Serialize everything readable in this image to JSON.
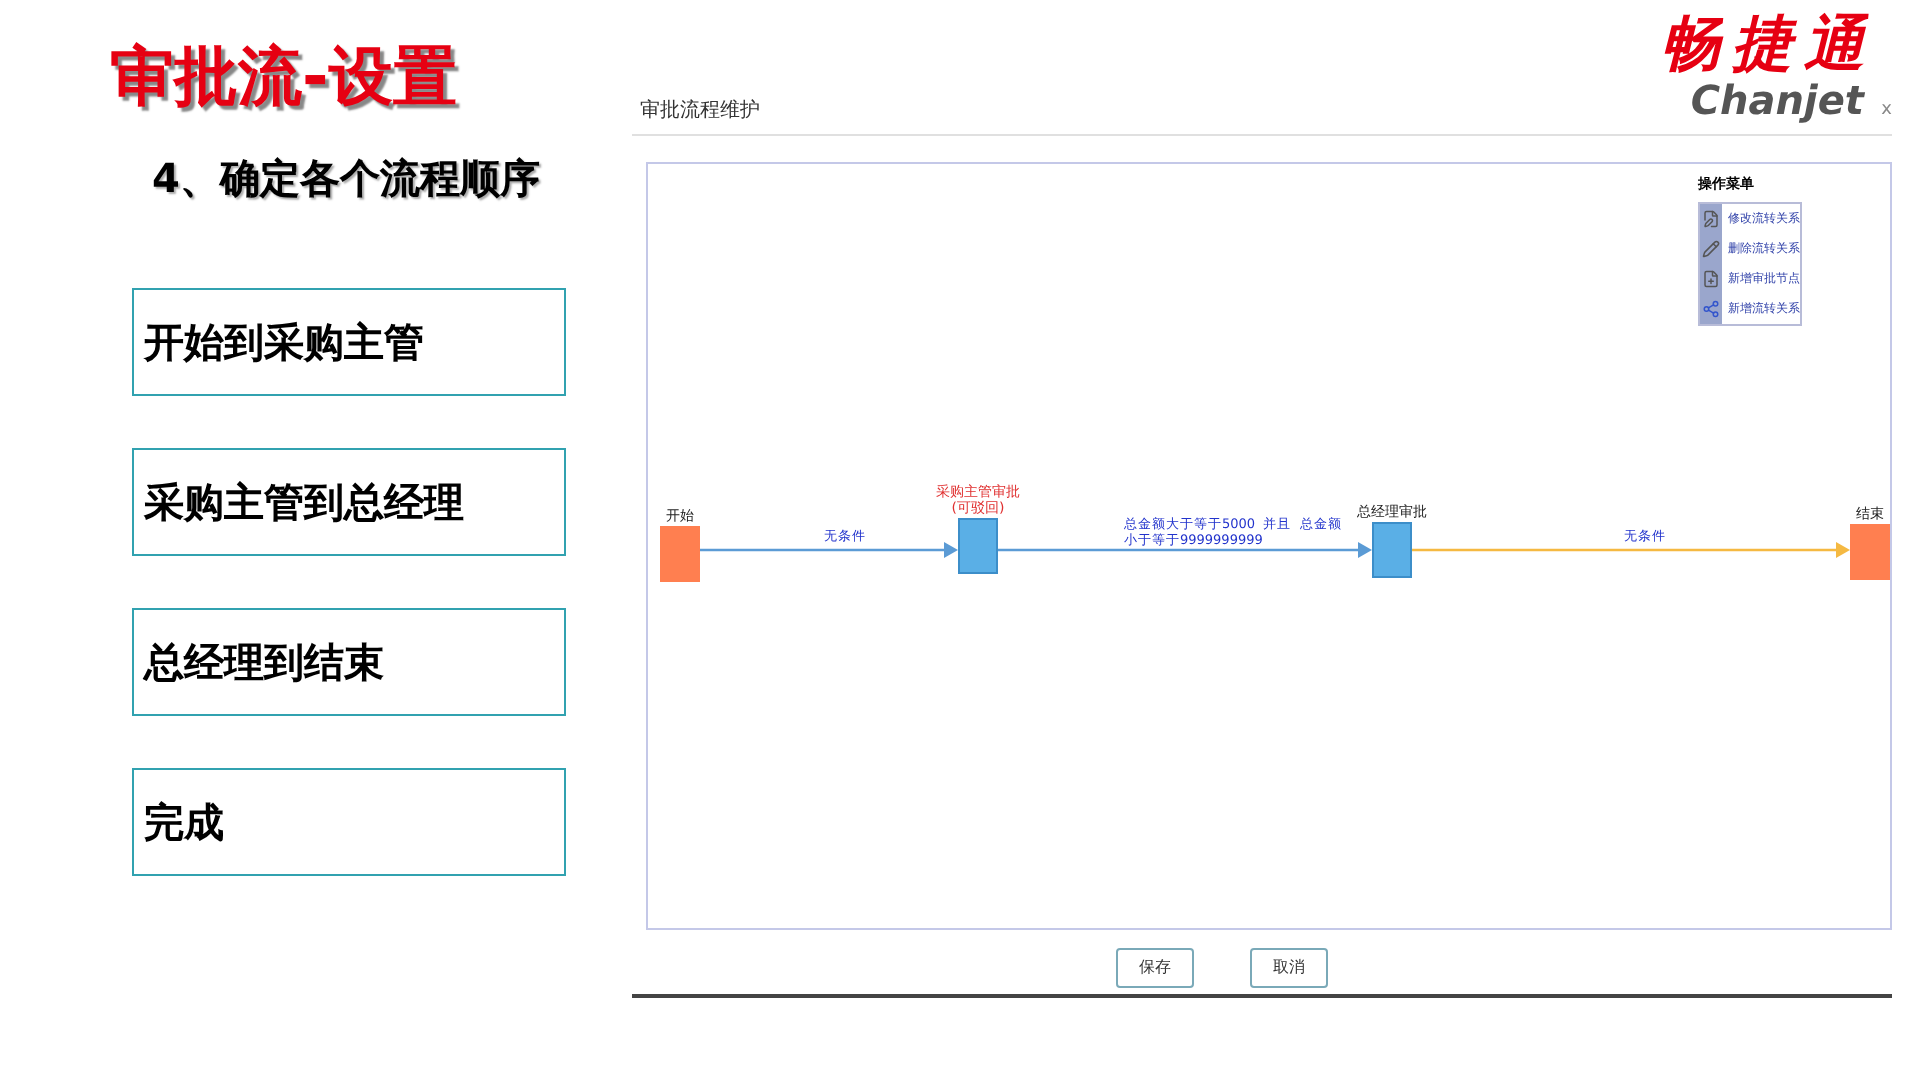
{
  "title": "审批流-设置",
  "logo": {
    "name": "畅捷通",
    "latin": "Chanjet"
  },
  "subtitle": "4、确定各个流程顺序",
  "steps": [
    "开始到采购主管",
    "采购主管到总经理",
    "总经理到结束",
    "完成"
  ],
  "dialog": {
    "title": "审批流程维护",
    "close": "x",
    "menu": {
      "title": "操作菜单",
      "items": [
        {
          "kind": "edit",
          "label": "修改流转关系"
        },
        {
          "kind": "delete",
          "label": "删除流转关系"
        },
        {
          "kind": "add-node",
          "label": "新增审批节点"
        },
        {
          "kind": "add-link",
          "label": "新增流转关系"
        }
      ]
    },
    "nodes": [
      {
        "kind": "start",
        "label": "开始"
      },
      {
        "kind": "approval",
        "label": "采购主管审批",
        "note": "(可驳回)"
      },
      {
        "kind": "approval",
        "label": "总经理审批"
      },
      {
        "kind": "end",
        "label": "结束"
      }
    ],
    "edges": [
      {
        "color": "#5b9bd5",
        "lines": [
          "无条件"
        ]
      },
      {
        "color": "#5b9bd5",
        "lines": [
          "总金额大于等于5000  并且  总金额",
          "小于等于9999999999"
        ]
      },
      {
        "color": "#f5b942",
        "lines": [
          "无条件"
        ]
      }
    ],
    "buttons": [
      "保存",
      "取消"
    ]
  }
}
